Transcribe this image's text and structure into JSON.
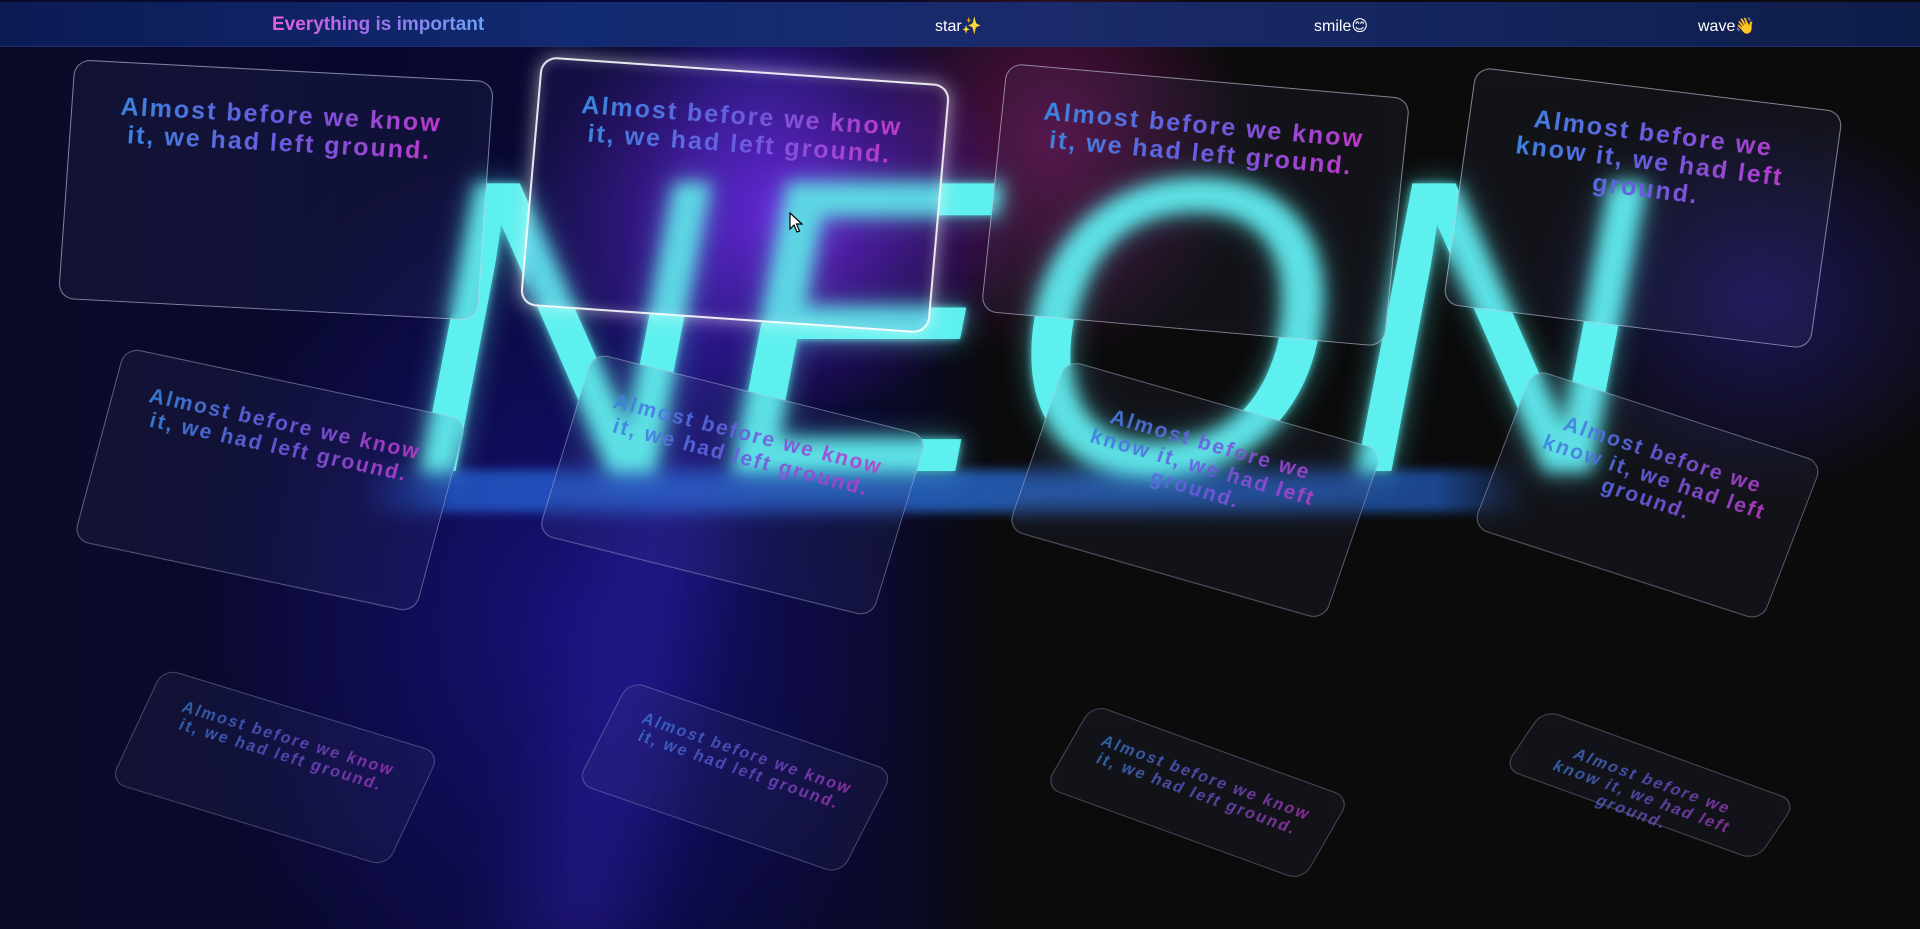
{
  "nav": {
    "brand": "Everything is important",
    "links": [
      {
        "label": "star✨"
      },
      {
        "label": "smile😊"
      },
      {
        "label": "wave👋"
      }
    ]
  },
  "hero": {
    "word": "NEON"
  },
  "cards": {
    "text": "Almost before we know it, we had left ground."
  },
  "colors": {
    "neon": "#5ef0ef",
    "accent_pink": "#d62fc6",
    "accent_blue": "#2d90e0",
    "nav_bg": "#122a72"
  }
}
